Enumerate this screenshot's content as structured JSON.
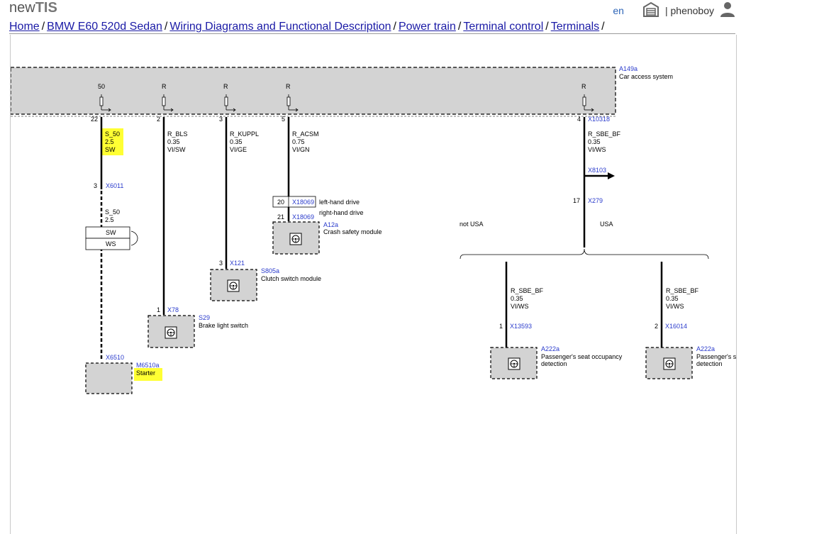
{
  "header": {
    "logo_prefix": "new",
    "logo_bold": "TIS",
    "language": "en",
    "username": "| phenoboy"
  },
  "breadcrumb": [
    "Home",
    "BMW E60 520d Sedan",
    "Wiring Diagrams and Functional Description",
    "Power train",
    "Terminal control",
    "Terminals"
  ],
  "breadcrumb_sep": "/",
  "icons": [
    "garage-icon",
    "user-icon"
  ],
  "colors": {
    "highlight": "#ffff33",
    "module_fill": "#d3d3d3",
    "link": "#2a3bcc"
  },
  "diagram": {
    "cas": {
      "id": "A149a",
      "name": "Car access system"
    },
    "pins": {
      "p22_top": "50",
      "p22": "22",
      "p2_top": "R",
      "p2": "2",
      "p3_top": "R",
      "p3": "3",
      "p5_top": "R",
      "p5": "5",
      "p4_top": "R",
      "p4": "4",
      "p4_conn": "X10318"
    },
    "wire1": {
      "l1": "S_50",
      "l2": "2.5",
      "l3": "SW",
      "pin": "3",
      "conn": "X6011",
      "b1": "S_50",
      "b2": "2.5",
      "opt_sw": "SW",
      "opt_ws": "WS",
      "conn_end": "X6510"
    },
    "starter": {
      "id": "M6510a",
      "name": "Starter"
    },
    "wire2": {
      "l1": "R_BLS",
      "l2": "0.35",
      "l3": "VI/SW",
      "pin": "1",
      "conn": "X78"
    },
    "brake": {
      "id": "S29",
      "name": "Brake light switch"
    },
    "wire3": {
      "l1": "R_KUPPL",
      "l2": "0.35",
      "l3": "VI/GE",
      "pin": "3",
      "conn": "X121"
    },
    "clutch": {
      "id": "S805a",
      "name": "Clutch switch module"
    },
    "wire4": {
      "l1": "R_ACSM",
      "l2": "0.75",
      "l3": "VI/GN",
      "lhd_pin": "20",
      "lhd_conn": "X18069",
      "lhd_text": "left-hand drive",
      "rhd_pin": "21",
      "rhd_conn": "X18069",
      "rhd_text": "right-hand drive"
    },
    "crash": {
      "id": "A12a",
      "name": "Crash safety module"
    },
    "wire5": {
      "l1": "R_SBE_BF",
      "l2": "0.35",
      "l3": "VI/WS",
      "branch_conn": "X8103",
      "pin": "17",
      "conn": "X279",
      "not_usa": "not USA",
      "usa": "USA"
    },
    "wire6": {
      "l1": "R_SBE_BF",
      "l2": "0.35",
      "l3": "VI/WS",
      "pin": "1",
      "conn": "X13593"
    },
    "seat1": {
      "id": "A222a",
      "name1": "Passenger's seat occupancy",
      "name2": "detection"
    },
    "wire7": {
      "l1": "R_SBE_BF",
      "l2": "0.35",
      "l3": "VI/WS",
      "pin": "2",
      "conn": "X16014"
    },
    "seat2": {
      "id": "A222a",
      "name1": "Passenger's s",
      "name2": "detection"
    }
  }
}
